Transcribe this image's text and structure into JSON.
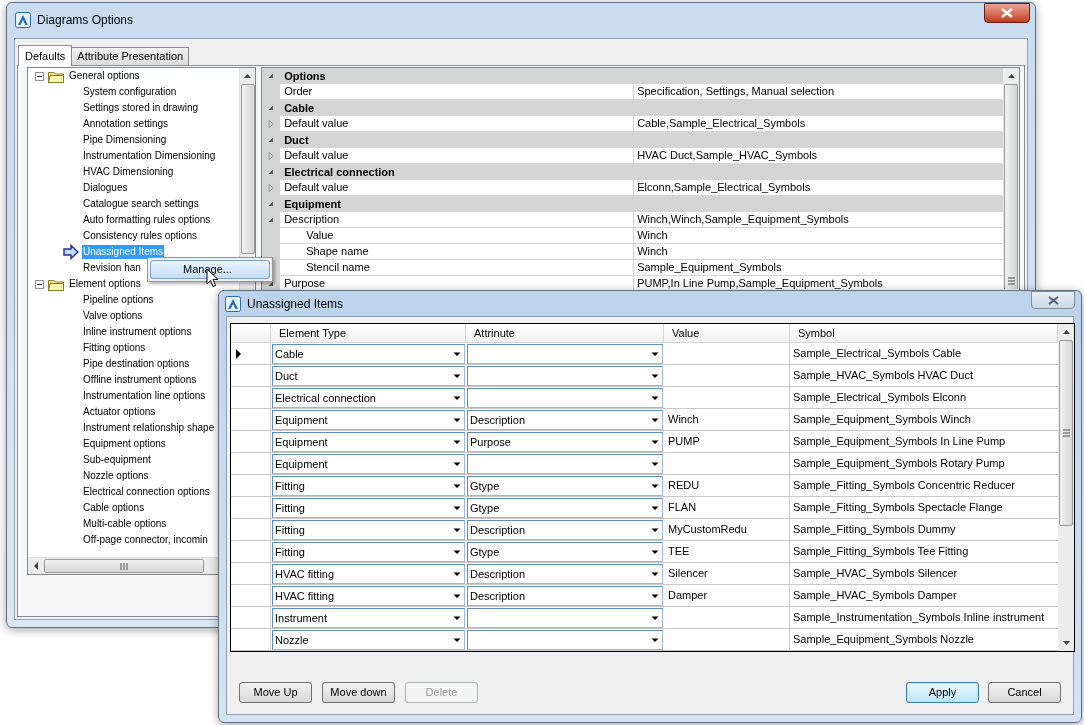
{
  "main_window": {
    "title": "Diagrams Options",
    "tabs": [
      {
        "label": "Defaults",
        "selected": true
      },
      {
        "label": "Attribute Presentation",
        "selected": false
      }
    ],
    "tree": [
      {
        "label": "General options",
        "expanded": true,
        "selected": false,
        "children": [
          {
            "label": "System configuration",
            "selected": false
          },
          {
            "label": "Settings stored in drawing",
            "selected": false
          },
          {
            "label": "Annotation settings",
            "selected": false
          },
          {
            "label": "Pipe Dimensioning",
            "selected": false
          },
          {
            "label": "Instrumentation Dimensioning",
            "selected": false
          },
          {
            "label": "HVAC Dimensioning",
            "selected": false
          },
          {
            "label": "Dialogues",
            "selected": false
          },
          {
            "label": "Catalogue search settings",
            "selected": false
          },
          {
            "label": "Auto formatting rules options",
            "selected": false
          },
          {
            "label": "Consistency rules options",
            "selected": false
          },
          {
            "label": "Unassigned Items",
            "selected": true
          },
          {
            "label": "Revision han",
            "selected": false
          }
        ]
      },
      {
        "label": "Element options",
        "expanded": true,
        "selected": false,
        "children": [
          {
            "label": "Pipeline options",
            "selected": false
          },
          {
            "label": "Valve options",
            "selected": false
          },
          {
            "label": "Inline instrument options",
            "selected": false
          },
          {
            "label": "Fitting options",
            "selected": false
          },
          {
            "label": "Pipe destination options",
            "selected": false
          },
          {
            "label": "Offline instrument options",
            "selected": false
          },
          {
            "label": "Instrumentation line options",
            "selected": false
          },
          {
            "label": "Actuator options",
            "selected": false
          },
          {
            "label": "Instrument relationship shape",
            "selected": false
          },
          {
            "label": "Equipment options",
            "selected": false
          },
          {
            "label": "Sub-equipment",
            "selected": false
          },
          {
            "label": "Nozzle options",
            "selected": false
          },
          {
            "label": "Electrical connection options",
            "selected": false
          },
          {
            "label": "Cable options",
            "selected": false
          },
          {
            "label": "Multi-cable options",
            "selected": false
          },
          {
            "label": "Off-page connector, incomin",
            "selected": false
          }
        ]
      }
    ],
    "property_grid": [
      {
        "category": "Options",
        "expanded": true,
        "properties": [
          {
            "name": "Order",
            "value": "Specification, Settings, Manual selection"
          }
        ]
      },
      {
        "category": "Cable",
        "expanded": true,
        "properties": [
          {
            "name": "Default value",
            "value": "Cable,Sample_Electrical_Symbols",
            "expanded": false
          }
        ]
      },
      {
        "category": "Duct",
        "expanded": true,
        "properties": [
          {
            "name": "Default value",
            "value": "HVAC Duct,Sample_HVAC_Symbols",
            "expanded": false
          }
        ]
      },
      {
        "category": "Electrical connection",
        "expanded": true,
        "properties": [
          {
            "name": "Default value",
            "value": "Elconn,Sample_Electrical_Symbols",
            "expanded": false
          }
        ]
      },
      {
        "category": "Equipment",
        "expanded": true,
        "properties": [
          {
            "name": "Description",
            "value": "Winch,Winch,Sample_Equipment_Symbols",
            "expanded": true,
            "children": [
              {
                "name": "Value",
                "value": "Winch"
              },
              {
                "name": "Shape name",
                "value": "Winch"
              },
              {
                "name": "Stencil name",
                "value": "Sample_Equipment_Symbols"
              }
            ]
          },
          {
            "name": "Purpose",
            "value": "PUMP,In Line Pump,Sample_Equipment_Symbols",
            "expanded": true
          }
        ]
      }
    ]
  },
  "context_menu": {
    "items": [
      {
        "label": "Manage...",
        "selected": true
      }
    ]
  },
  "dialog": {
    "title": "Unassigned Items",
    "columns": [
      "Element Type",
      "Attrinute",
      "Value",
      "Symbol"
    ],
    "rows": [
      {
        "current": true,
        "element_type": "Cable",
        "symbol": "Sample_Electrical_Symbols Cable"
      },
      {
        "current": false,
        "element_type": "Duct",
        "symbol": "Sample_HVAC_Symbols HVAC Duct"
      },
      {
        "current": false,
        "element_type": "Electrical connection",
        "symbol": "Sample_Electrical_Symbols Elconn"
      },
      {
        "current": false,
        "element_type": "Equipment",
        "attribute": "Description",
        "value": "Winch",
        "symbol": "Sample_Equipment_Symbols Winch"
      },
      {
        "current": false,
        "element_type": "Equipment",
        "attribute": "Purpose",
        "value": "PUMP",
        "symbol": "Sample_Equipment_Symbols In Line Pump"
      },
      {
        "current": false,
        "element_type": "Equipment",
        "symbol": "Sample_Equipment_Symbols Rotary Pump"
      },
      {
        "current": false,
        "element_type": "Fitting",
        "attribute": "Gtype",
        "value": "REDU",
        "symbol": "Sample_Fitting_Symbols Concentric Reducer"
      },
      {
        "current": false,
        "element_type": "Fitting",
        "attribute": "Gtype",
        "value": "FLAN",
        "symbol": "Sample_Fitting_Symbols Spectacle Flange"
      },
      {
        "current": false,
        "element_type": "Fitting",
        "attribute": "Description",
        "value": "MyCustomRedu",
        "symbol": "Sample_Fitting_Symbols Dummy"
      },
      {
        "current": false,
        "element_type": "Fitting",
        "attribute": "Gtype",
        "value": "TEE",
        "symbol": "Sample_Fitting_Symbols Tee Fitting"
      },
      {
        "current": false,
        "element_type": "HVAC fitting",
        "attribute": "Description",
        "value": "Silencer",
        "symbol": "Sample_HVAC_Symbols Silencer"
      },
      {
        "current": false,
        "element_type": "HVAC fitting",
        "attribute": "Description",
        "value": "Damper",
        "symbol": "Sample_HVAC_Symbols Damper"
      },
      {
        "current": false,
        "element_type": "Instrument",
        "symbol": "Sample_Instrumentation_Symbols Inline instrument"
      },
      {
        "current": false,
        "element_type": "Nozzle",
        "symbol": "Sample_Equipment_Symbols Nozzle"
      }
    ],
    "left_buttons": [
      {
        "label": "Move Up",
        "disabled": false,
        "focused": false
      },
      {
        "label": "Move down",
        "disabled": false,
        "focused": false
      },
      {
        "label": "Delete",
        "disabled": true,
        "focused": false
      }
    ],
    "right_buttons": [
      {
        "label": "Apply",
        "disabled": false,
        "focused": true
      },
      {
        "label": "Cancel",
        "disabled": false,
        "focused": false
      }
    ]
  }
}
